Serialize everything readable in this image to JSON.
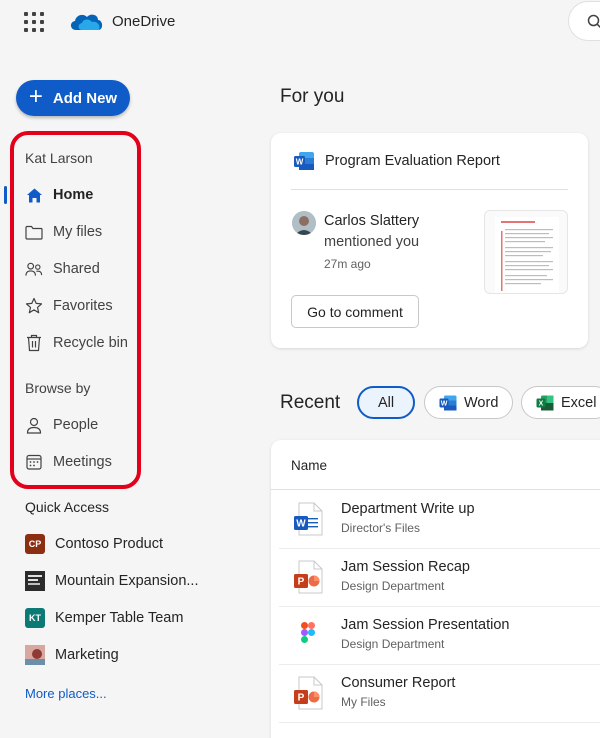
{
  "app": {
    "title": "OneDrive"
  },
  "sidebar": {
    "add_new_label": "Add New",
    "user_name": "Kat Larson",
    "nav": [
      {
        "label": "Home",
        "icon": "home-icon"
      },
      {
        "label": "My files",
        "icon": "folder-icon"
      },
      {
        "label": "Shared",
        "icon": "people-icon"
      },
      {
        "label": "Favorites",
        "icon": "star-icon"
      },
      {
        "label": "Recycle bin",
        "icon": "trash-icon"
      }
    ],
    "browse_heading": "Browse by",
    "browse": [
      {
        "label": "People",
        "icon": "person-icon"
      },
      {
        "label": "Meetings",
        "icon": "calendar-icon"
      }
    ],
    "quick_access_heading": "Quick Access",
    "quick_access": [
      {
        "label": "Contoso Product",
        "badge": "CP",
        "color": "#8b2e12"
      },
      {
        "label": "Mountain Expansion...",
        "badge": "",
        "color": "#3a3a3a"
      },
      {
        "label": "Kemper Table Team",
        "badge": "KT",
        "color": "#0b7a75"
      },
      {
        "label": "Marketing",
        "badge": "",
        "color": "#b5605a"
      }
    ],
    "more_places": "More places..."
  },
  "for_you": {
    "heading": "For you",
    "card": {
      "doc_title": "Program Evaluation Report",
      "person": "Carlos Slattery",
      "action": "mentioned you",
      "time": "27m ago",
      "button": "Go to comment"
    }
  },
  "recent": {
    "heading": "Recent",
    "filters": [
      "All",
      "Word",
      "Excel"
    ],
    "column_name": "Name",
    "files": [
      {
        "name": "Department Write up",
        "location": "Director's Files",
        "type": "word"
      },
      {
        "name": "Jam Session Recap",
        "location": "Design Department",
        "type": "powerpoint"
      },
      {
        "name": "Jam Session Presentation",
        "location": "Design Department",
        "type": "figma"
      },
      {
        "name": "Consumer Report",
        "location": "My Files",
        "type": "powerpoint"
      }
    ]
  },
  "colors": {
    "accent": "#0f5bc7",
    "highlight": "#e3001b",
    "word": "#185abd",
    "excel": "#107c41",
    "powerpoint": "#c43e1c"
  }
}
